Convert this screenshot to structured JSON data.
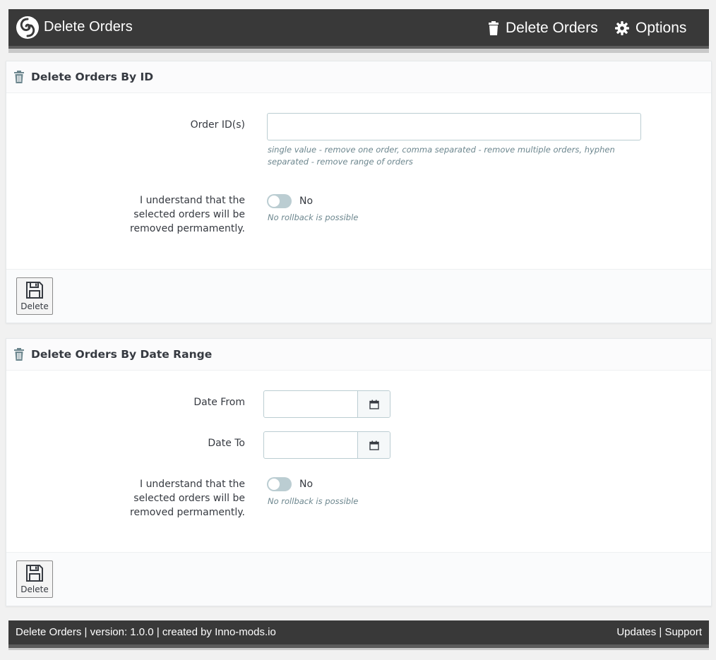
{
  "header": {
    "app_title": "Delete Orders",
    "nav_delete": "Delete Orders",
    "nav_options": "Options"
  },
  "panel_by_id": {
    "title": "Delete Orders By ID",
    "order_ids_label": "Order ID(s)",
    "order_ids_value": "",
    "order_ids_help": "single value - remove one order, comma separated - remove multiple orders, hyphen separated - remove range of orders",
    "confirm_label": "I understand that the selected orders will be removed permamently.",
    "confirm_state": "No",
    "confirm_help": "No rollback is possible",
    "delete_button": "Delete"
  },
  "panel_by_date": {
    "title": "Delete Orders By Date Range",
    "date_from_label": "Date From",
    "date_from_value": "",
    "date_to_label": "Date To",
    "date_to_value": "",
    "confirm_label": "I understand that the selected orders will be removed permamently.",
    "confirm_state": "No",
    "confirm_help": "No rollback is possible",
    "delete_button": "Delete"
  },
  "footer": {
    "prefix": "Delete Orders | version: 1.0.0 | created by ",
    "author_link": "Inno-mods.io",
    "updates_link": "Updates",
    "separator": " | ",
    "support_link": "Support"
  },
  "icons": {
    "logo": "swirl-logo-icon",
    "trash": "trash-icon",
    "gear": "gear-icon",
    "calendar": "calendar-icon",
    "save": "floppy-disk-icon"
  },
  "colors": {
    "header_bg": "#393939",
    "toggle_off": "#bbcdd2",
    "help_text": "#6c868e"
  }
}
